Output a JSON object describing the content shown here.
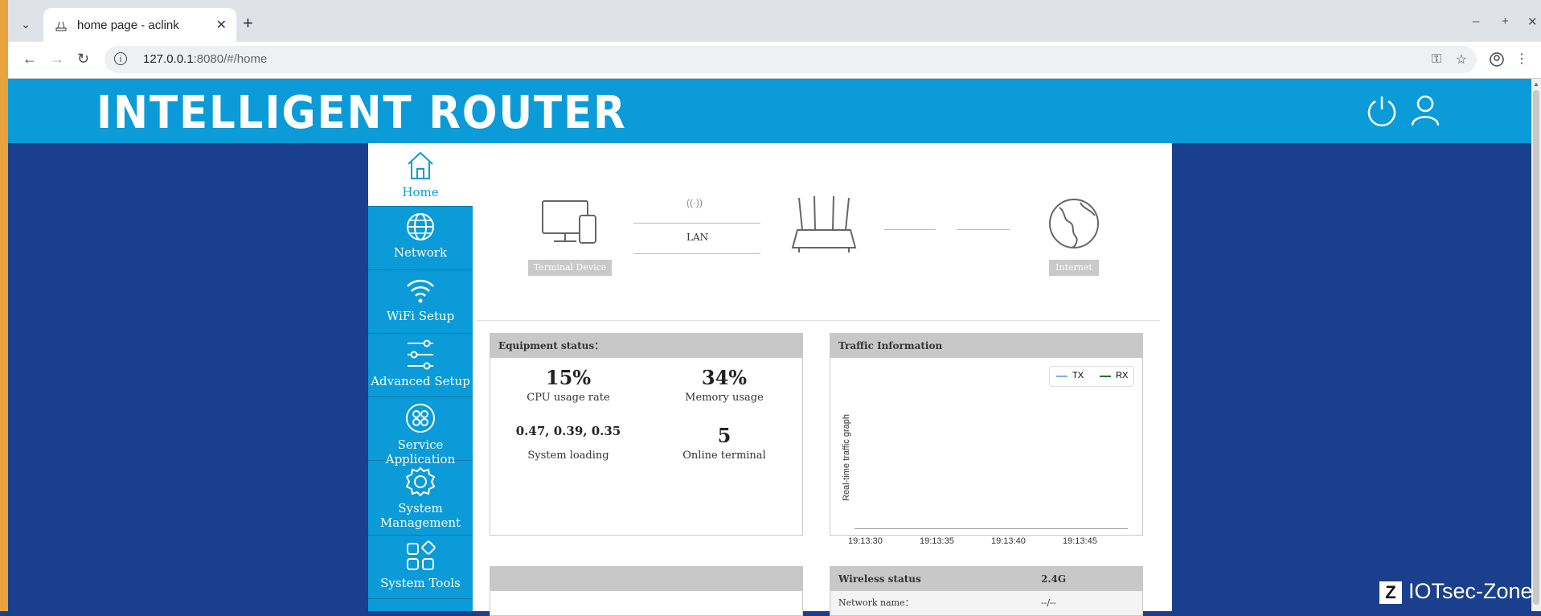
{
  "browser": {
    "tab_title": "home page - aclink",
    "url_host": "127.0.0.1",
    "url_rest": ":8080/#/home",
    "new_tab": "+",
    "close": "✕"
  },
  "router": {
    "logo": "INTELLIGENT ROUTER"
  },
  "sidebar": {
    "items": [
      {
        "label": "Home",
        "icon": "home-icon",
        "active": true
      },
      {
        "label": "Network",
        "icon": "globe-icon"
      },
      {
        "label": "WiFi Setup",
        "icon": "wifi-icon"
      },
      {
        "label": "Advanced Setup",
        "icon": "sliders-icon"
      },
      {
        "label": "Service Application",
        "icon": "service-icon"
      },
      {
        "label": "System Management",
        "icon": "gear-icon"
      },
      {
        "label": "System Tools",
        "icon": "tools-icon"
      }
    ]
  },
  "topology": {
    "terminal_label": "Terminal Device",
    "lan_label": "LAN",
    "internet_label": "Internet"
  },
  "equipment": {
    "title": "Equipment status：",
    "cpu_value": "15%",
    "cpu_label": "CPU usage rate",
    "mem_value": "34%",
    "mem_label": "Memory usage",
    "load_value": "0.47, 0.39, 0.35",
    "load_label": "System loading",
    "online_value": "5",
    "online_label": "Online terminal"
  },
  "traffic": {
    "title": "Traffic Information",
    "legend_tx": "TX",
    "legend_rx": "RX",
    "tx_color": "#7ab0e8",
    "rx_color": "#1f7a1f",
    "y_label": "Real-time traffic graph",
    "x_ticks": [
      "19:13:30",
      "19:13:35",
      "19:13:40",
      "19:13:45"
    ]
  },
  "wireless": {
    "title": "Wireless status",
    "band": "2.4G",
    "network_name_label": "Network name：",
    "network_name_value": "--/--"
  },
  "watermark": {
    "logo": "Z",
    "text": "IOTsec-Zone"
  }
}
